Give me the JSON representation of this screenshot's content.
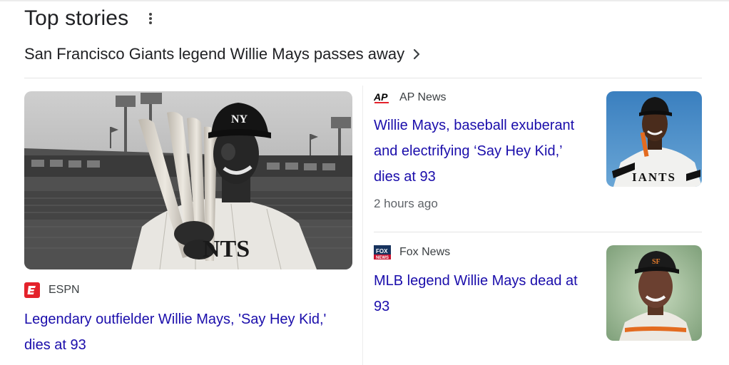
{
  "header": {
    "title": "Top stories"
  },
  "topic": {
    "label": "San Francisco Giants legend Willie Mays passes away"
  },
  "lead_story": {
    "source": "ESPN",
    "headline": "Legendary outfielder Willie Mays, 'Say Hey Kid,' dies at 93",
    "image_text": "NTS",
    "logo_icon": "espn-logo-icon",
    "brand_color": "#e4222b"
  },
  "stories": [
    {
      "source": "AP News",
      "headline": "Willie Mays, baseball exuberant and electrifying ‘Say Hey Kid,’ dies at 93",
      "time": "2 hours ago",
      "image_text": "IANTS",
      "logo_icon": "ap-logo-icon"
    },
    {
      "source": "Fox News",
      "headline": "MLB legend Willie Mays dead at 93",
      "logo_icon": "fox-news-logo-icon"
    }
  ],
  "colors": {
    "link": "#1a0dab",
    "text": "#202124",
    "muted": "#5f6368"
  }
}
